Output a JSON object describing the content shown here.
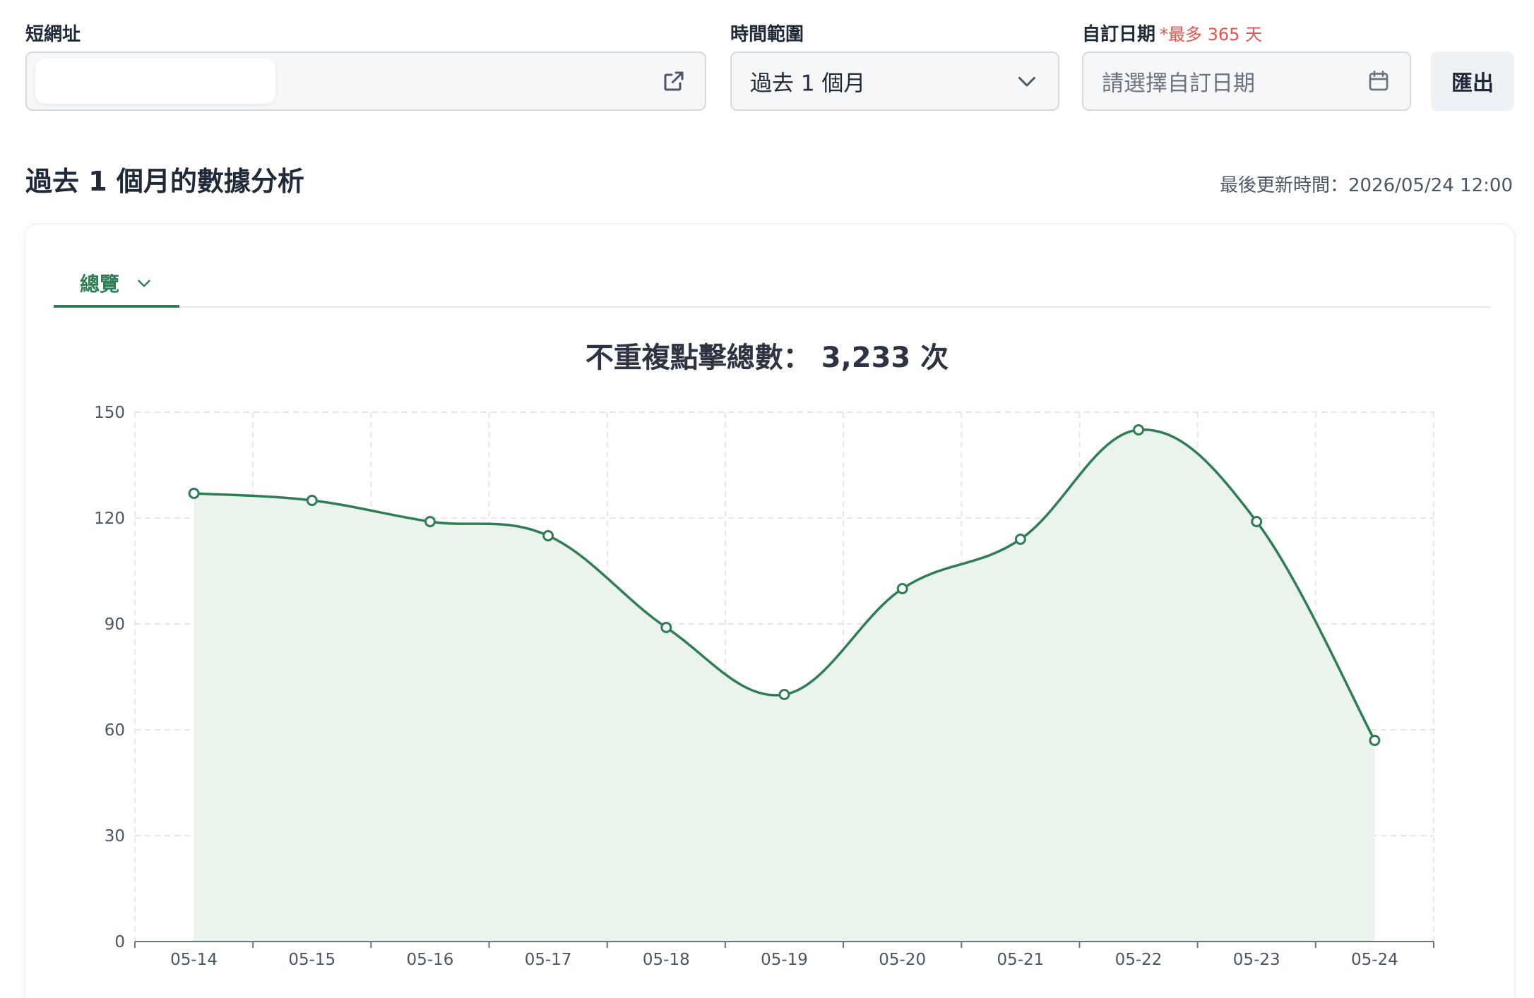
{
  "filters": {
    "short_url": {
      "label": "短網址",
      "value": ""
    },
    "time_range": {
      "label": "時間範圍",
      "value": "過去 1 個月"
    },
    "custom_date": {
      "label": "自訂日期",
      "hint": "*最多 365 天",
      "placeholder": "請選擇自訂日期"
    },
    "export_label": "匯出"
  },
  "heading": {
    "title": "過去 1 個月的數據分析",
    "updated": "最後更新時間：2026/05/24 12:00"
  },
  "tabs": [
    {
      "label": "總覽",
      "active": true
    }
  ],
  "chart_title": "不重複點擊總數： 3,233 次",
  "colors": {
    "accent": "#2f7d55",
    "area_fill": "#eaf3ec",
    "grid": "#e4e7eb",
    "warning": "#e5534b"
  },
  "icons": {
    "short_url": "external-link-icon",
    "time_range": "chevron-down-icon",
    "custom_date": "calendar-icon",
    "tab": "chevron-down-icon"
  },
  "chart_data": {
    "type": "area",
    "title": "",
    "xlabel": "",
    "ylabel": "",
    "categories": [
      "05-14",
      "05-15",
      "05-16",
      "05-17",
      "05-18",
      "05-19",
      "05-20",
      "05-21",
      "05-22",
      "05-23",
      "05-24"
    ],
    "values": [
      127,
      125,
      119,
      115,
      89,
      70,
      100,
      114,
      145,
      119,
      57
    ],
    "ylim": [
      0,
      150
    ],
    "yticks": [
      0,
      30,
      60,
      90,
      120,
      150
    ],
    "grid": true,
    "smooth": true,
    "markers": "hollow-circle",
    "legend": "none"
  }
}
